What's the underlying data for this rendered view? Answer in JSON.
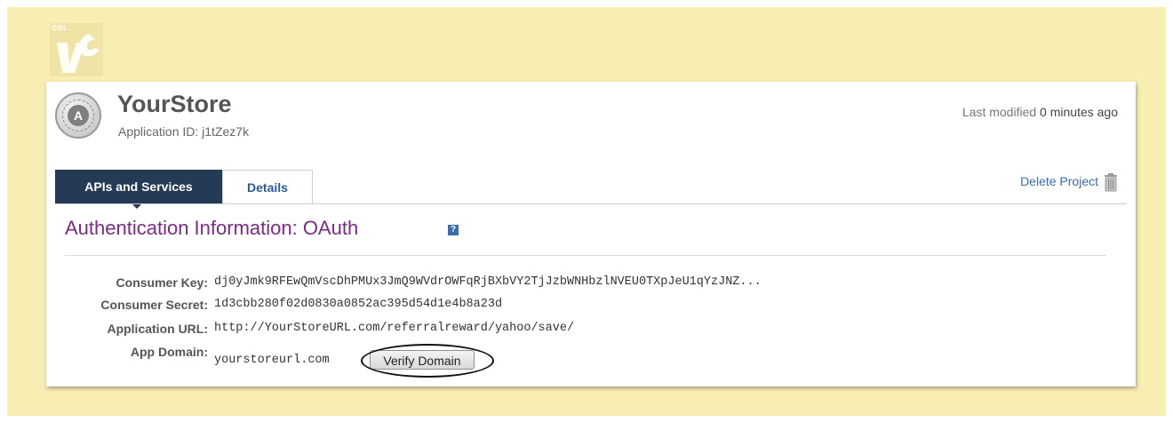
{
  "logo": {
    "text": "OBL"
  },
  "header": {
    "app_name": "YourStore",
    "app_id": "Application ID: j1tZez7k",
    "badge_letter": "A",
    "last_modified_prefix": "Last modified",
    "last_modified_value": "0 minutes ago"
  },
  "tabs": [
    {
      "label": "APIs and Services",
      "active": true
    },
    {
      "label": "Details",
      "active": false
    }
  ],
  "actions": {
    "delete_project": "Delete Project"
  },
  "section": {
    "title": "Authentication Information: OAuth",
    "help": "?"
  },
  "fields": [
    {
      "label": "Consumer Key:",
      "value": "dj0yJmk9RFEwQmVscDhPMUx3JmQ9WVdrOWFqRjBXbVY2TjJzbWNHbzlNVEU0TXpJeU1qYzJNZ..."
    },
    {
      "label": "Consumer Secret:",
      "value": "1d3cbb280f02d0830a0852ac395d54d1e4b8a23d"
    },
    {
      "label": "Application URL:",
      "value": "http://YourStoreURL.com/referralreward/yahoo/save/"
    },
    {
      "label": "App Domain:",
      "value": "yourstoreurl.com"
    }
  ],
  "verify_button": "Verify Domain",
  "colors": {
    "background": "#f8eeb3",
    "tab_active": "#243a55",
    "title": "#7b2a86",
    "link": "#3a6bb0"
  },
  "icons": {
    "logo": "company-logo",
    "oauth": "oauth-badge-icon",
    "trash": "trash-icon",
    "help": "help-icon"
  }
}
